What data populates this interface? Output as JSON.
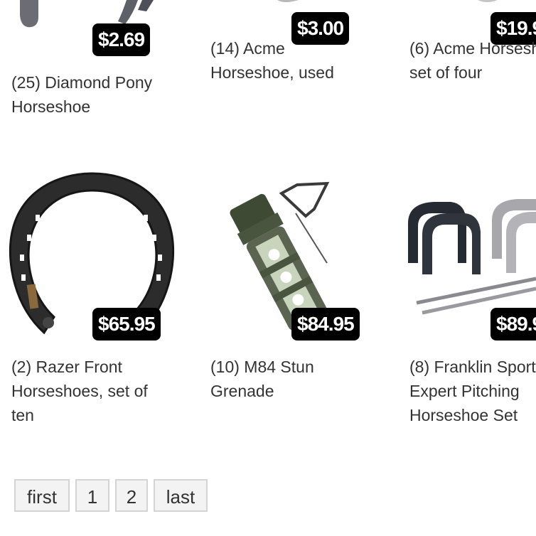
{
  "products": [
    {
      "price": "$2.69",
      "title_line1": "(25) Diamond Pony",
      "title_line2": "Horseshoe",
      "title_line3": "",
      "image": "horseshoe-icon"
    },
    {
      "price": "$3.00",
      "title_line1": "(14) Acme",
      "title_line2": "Horseshoe, used",
      "title_line3": "",
      "image": "horseshoe-icon"
    },
    {
      "price": "$19.9",
      "title_line1": "(6) Acme Horsesh",
      "title_line2": "set of four",
      "title_line3": "",
      "image": "horseshoe-icon"
    },
    {
      "price": "$65.95",
      "title_line1": "(2) Razer Front",
      "title_line2": "Horseshoes, set of",
      "title_line3": "ten",
      "image": "horseshoe-icon"
    },
    {
      "price": "$84.95",
      "title_line1": "(10) M84 Stun",
      "title_line2": "Grenade",
      "title_line3": "",
      "image": "grenade-icon"
    },
    {
      "price": "$89.9",
      "title_line1": "(8) Franklin Sport",
      "title_line2": "Expert Pitching",
      "title_line3": "Horseshoe Set",
      "image": "horseshoe-set-icon"
    }
  ],
  "pagination": {
    "first": "first",
    "page1": "1",
    "page2": "2",
    "last": "last"
  }
}
